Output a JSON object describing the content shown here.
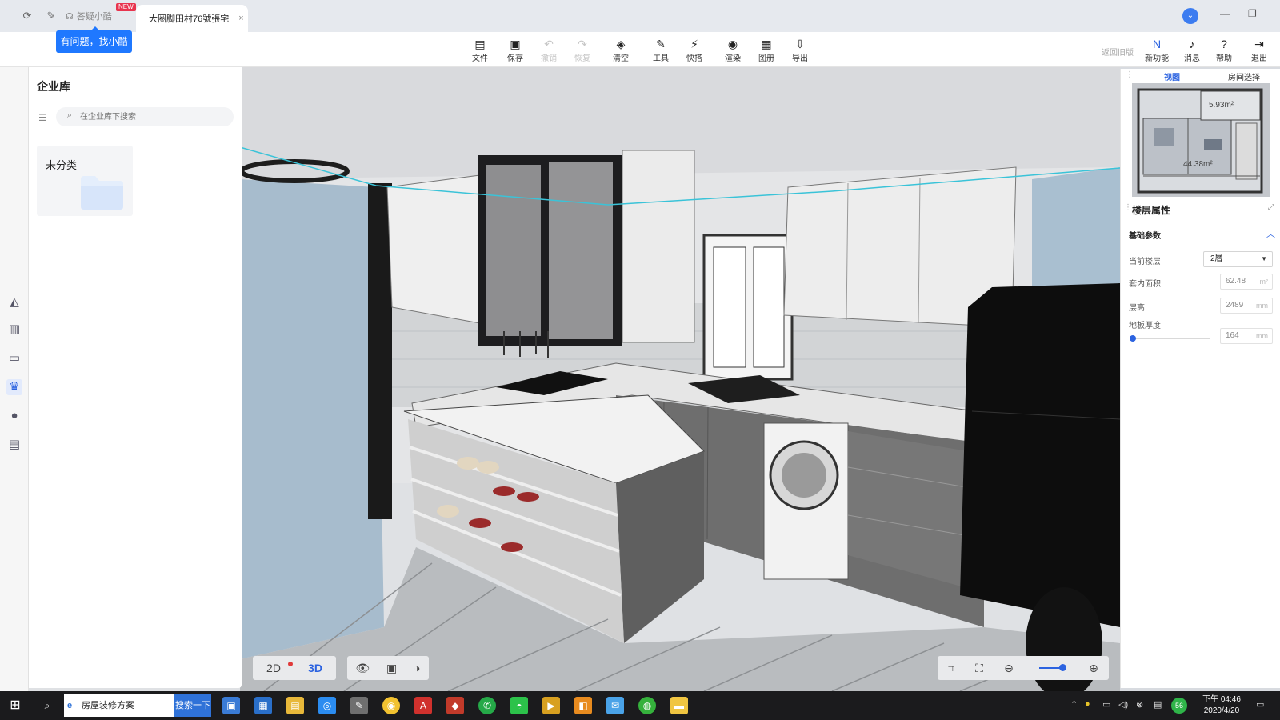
{
  "tabs": {
    "helper_tab": "答疑小酷",
    "new_badge": "NEW",
    "active_tab": "大圈脚田村76號張宅",
    "close_glyph": "×"
  },
  "helper_tooltip": "有问题，找小酷",
  "toolbar": {
    "items": [
      {
        "label": "文件",
        "icon": "file-icon",
        "glyph": "▤",
        "enabled": true
      },
      {
        "label": "保存",
        "icon": "save-icon",
        "glyph": "▣",
        "enabled": true
      },
      {
        "label": "撤销",
        "icon": "undo-icon",
        "glyph": "↶",
        "enabled": false
      },
      {
        "label": "恢复",
        "icon": "redo-icon",
        "glyph": "↷",
        "enabled": false
      },
      {
        "label": "清空",
        "icon": "eraser-icon",
        "glyph": "◈",
        "enabled": true
      },
      {
        "label": "工具",
        "icon": "wrench-icon",
        "glyph": "✎",
        "enabled": true
      },
      {
        "label": "快搭",
        "icon": "lightning-icon",
        "glyph": "⚡",
        "enabled": true
      },
      {
        "label": "渲染",
        "icon": "camera-icon",
        "glyph": "◉",
        "enabled": true
      },
      {
        "label": "图册",
        "icon": "album-icon",
        "glyph": "▦",
        "enabled": true
      },
      {
        "label": "导出",
        "icon": "export-icon",
        "glyph": "⇩",
        "enabled": true
      }
    ],
    "back_old": "返回旧版",
    "right_items": [
      {
        "label": "新功能",
        "icon": "new-feature-icon",
        "glyph": "N"
      },
      {
        "label": "消息",
        "icon": "bell-icon",
        "glyph": "♪"
      },
      {
        "label": "帮助",
        "icon": "help-icon",
        "glyph": "?"
      },
      {
        "label": "退出",
        "icon": "logout-icon",
        "glyph": "⇥"
      }
    ]
  },
  "library": {
    "title": "企业库",
    "search_placeholder": "在企业库下搜索",
    "folders": [
      {
        "label": "未分类"
      }
    ]
  },
  "view_controls": {
    "mode_2d": "2D",
    "mode_3d": "3D",
    "active_mode": "3D"
  },
  "right_panel": {
    "tab_view": "视图",
    "tab_room": "房间选择",
    "minimap_labels": [
      "5.93m²",
      "44.38m²"
    ],
    "section_title": "楼层属性",
    "sub_title": "基础参数",
    "fields": {
      "current_floor_label": "当前楼层",
      "current_floor_value": "2層",
      "area_label": "套内面积",
      "area_value": "62.48",
      "area_unit": "m²",
      "height_label": "层高",
      "height_value": "2489",
      "height_unit": "mm",
      "floor_thickness_label": "地板厚度",
      "floor_thickness_value": "164",
      "floor_thickness_unit": "mm"
    }
  },
  "taskbar": {
    "search_value": "房屋装修方案",
    "search_button": "搜索一下",
    "tray_badge": "56",
    "time": "下午 04:46",
    "date": "2020/4/20"
  }
}
